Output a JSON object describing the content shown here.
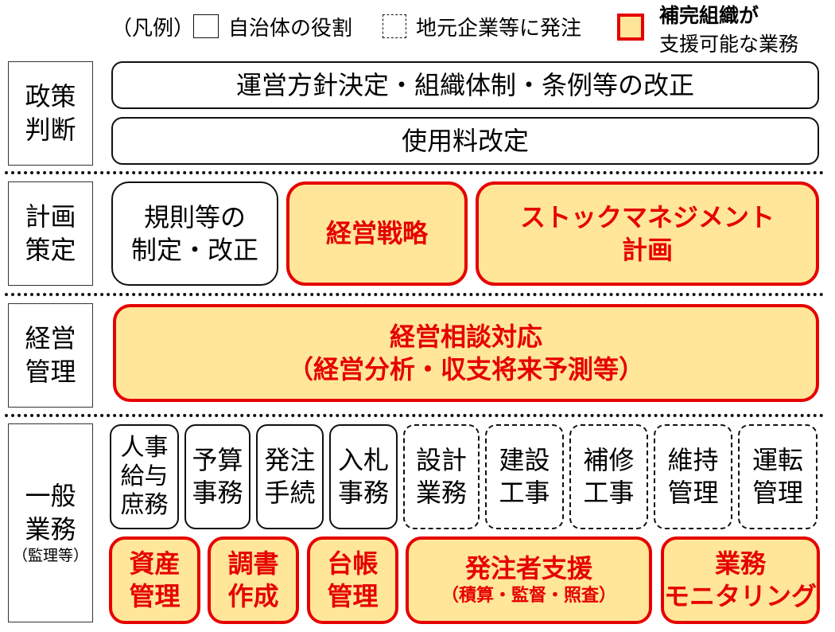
{
  "legend": {
    "title": "（凡例）",
    "items": [
      {
        "style": "solid",
        "label": "自治体の役割"
      },
      {
        "style": "dashed",
        "label": "地元企業等に発注"
      },
      {
        "style": "support",
        "label_line1": "補完組織が",
        "label_line2": "支援可能な業務"
      }
    ]
  },
  "colors": {
    "support_border": "#e60000",
    "support_fill": "#ffe699",
    "support_text": "#e60000"
  },
  "rows": [
    {
      "category": {
        "line1": "政策",
        "line2": "判断"
      },
      "boxes": [
        {
          "style": "solid",
          "lines": [
            "運営方針決定・組織体制・条例等の改正"
          ]
        },
        {
          "style": "solid",
          "lines": [
            "使用料改定"
          ]
        }
      ]
    },
    {
      "category": {
        "line1": "計画",
        "line2": "策定"
      },
      "boxes": [
        {
          "style": "solid",
          "lines": [
            "規則等の",
            "制定・改正"
          ]
        },
        {
          "style": "support",
          "lines": [
            "経営戦略"
          ]
        },
        {
          "style": "support",
          "lines": [
            "ストックマネジメント",
            "計画"
          ]
        }
      ]
    },
    {
      "category": {
        "line1": "経営",
        "line2": "管理"
      },
      "boxes": [
        {
          "style": "support",
          "lines": [
            "経営相談対応",
            "（経営分析・収支将来予測等）"
          ]
        }
      ]
    },
    {
      "category": {
        "line1": "一般",
        "line2": "業務",
        "line3": "（監理等）"
      },
      "boxes_top": [
        {
          "style": "solid",
          "lines": [
            "人事",
            "給与",
            "庶務"
          ]
        },
        {
          "style": "solid",
          "lines": [
            "予算",
            "事務"
          ]
        },
        {
          "style": "solid",
          "lines": [
            "発注",
            "手続"
          ]
        },
        {
          "style": "solid",
          "lines": [
            "入札",
            "事務"
          ]
        },
        {
          "style": "dashed",
          "lines": [
            "設計",
            "業務"
          ]
        },
        {
          "style": "dashed",
          "lines": [
            "建設",
            "工事"
          ]
        },
        {
          "style": "dashed",
          "lines": [
            "補修",
            "工事"
          ]
        },
        {
          "style": "dashed",
          "lines": [
            "維持",
            "管理"
          ]
        },
        {
          "style": "dashed",
          "lines": [
            "運転",
            "管理"
          ]
        }
      ],
      "boxes_bottom": [
        {
          "style": "support",
          "lines": [
            "資産",
            "管理"
          ]
        },
        {
          "style": "support",
          "lines": [
            "調書",
            "作成"
          ]
        },
        {
          "style": "support",
          "lines": [
            "台帳",
            "管理"
          ]
        },
        {
          "style": "support",
          "lines": [
            "発注者支援",
            "（積算・監督・照査）"
          ]
        },
        {
          "style": "support",
          "lines": [
            "業務",
            "モニタリング"
          ]
        }
      ]
    }
  ]
}
